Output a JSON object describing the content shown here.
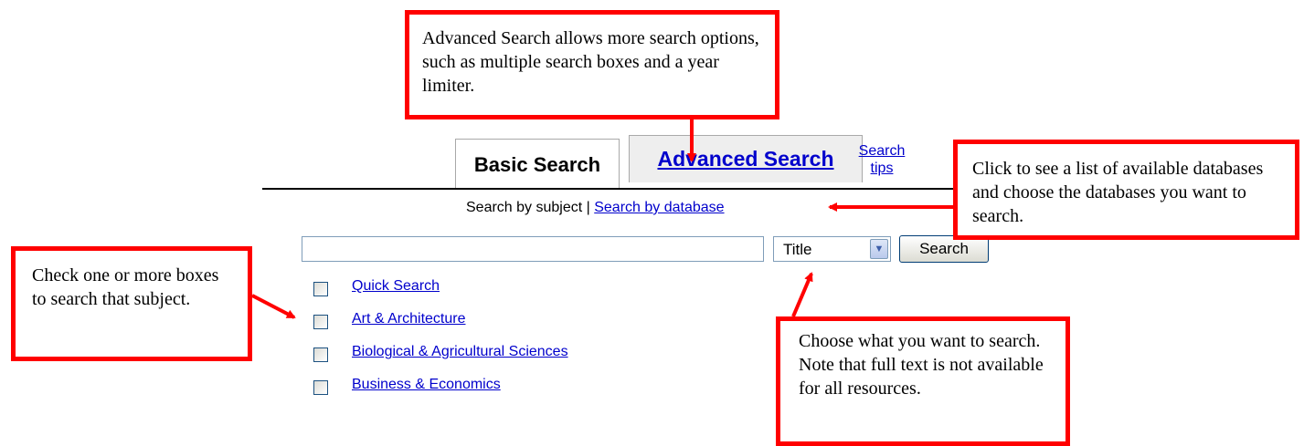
{
  "tabs": {
    "basic_label": "Basic Search",
    "advanced_label": "Advanced Search",
    "tips_line1": "Search",
    "tips_line2": "tips"
  },
  "subnav": {
    "by_subject": "Search by subject",
    "separator": " | ",
    "by_database": "Search by database"
  },
  "search": {
    "query_value": "",
    "field_selected": "Title",
    "button_label": "Search"
  },
  "subjects": [
    {
      "label": "Quick Search",
      "checked": false
    },
    {
      "label": "Art & Architecture",
      "checked": false
    },
    {
      "label": "Biological & Agricultural Sciences",
      "checked": false
    },
    {
      "label": "Business & Economics",
      "checked": false
    }
  ],
  "callouts": {
    "advanced": "Advanced Search allows more search options, such as multiple search boxes and a year limiter.",
    "database": "Click to see a list of available databases and choose the databases you want to search.",
    "checkbox": "Check one or more boxes to search that subject.",
    "choose": "Choose what you want to search.  Note that full text is not available for all resources."
  },
  "colors": {
    "callout_border": "#ff0000",
    "link": "#0000cc"
  }
}
